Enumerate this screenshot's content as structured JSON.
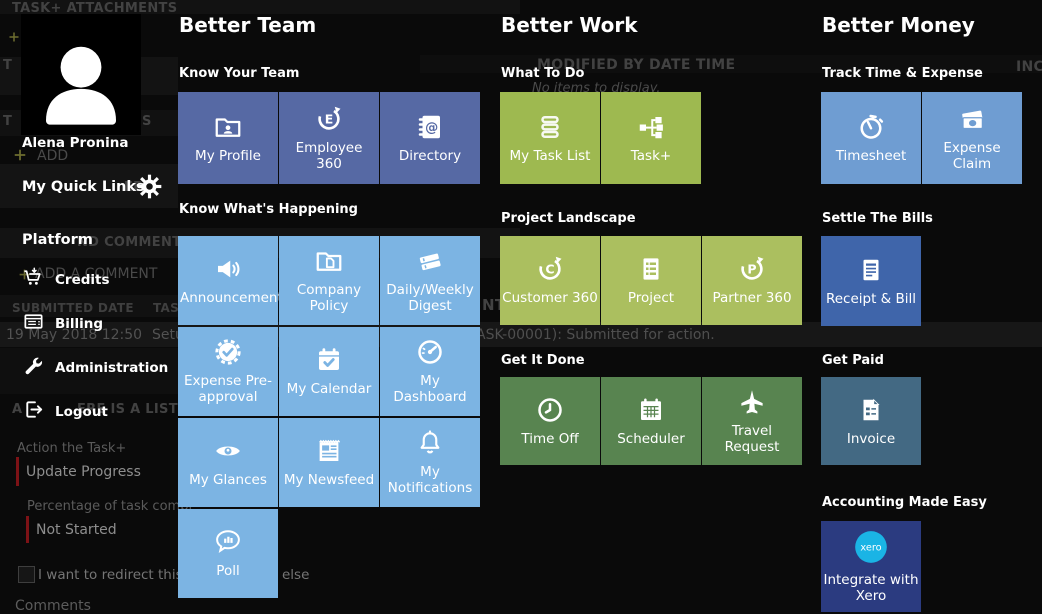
{
  "sidebar": {
    "user_name": "Alena Pronina",
    "quick_links_label": "My Quick Links",
    "platform_label": "Platform",
    "items": [
      {
        "label": "Credits",
        "icon": "cart"
      },
      {
        "label": "Billing",
        "icon": "billing-doc"
      },
      {
        "label": "Administration",
        "icon": "wrench"
      },
      {
        "label": "Logout",
        "icon": "logout-door"
      }
    ]
  },
  "menu": {
    "xero_logo_text": "xero",
    "columns": [
      {
        "title": "Better Team",
        "sections": [
          {
            "heading": "Know Your Team",
            "tile_color": "#5669a4",
            "tiles": [
              {
                "label": "My Profile",
                "icon": "profile-folder"
              },
              {
                "label": "Employee 360",
                "icon": "employee-360"
              },
              {
                "label": "Directory",
                "icon": "directory-book"
              }
            ]
          },
          {
            "heading": "Know What's Happening",
            "tile_color": "#7cb4e3",
            "tiles": [
              {
                "label": "Announcement",
                "icon": "announcement-speaker"
              },
              {
                "label": "Company Policy",
                "icon": "policy-folder"
              },
              {
                "label": "Daily/Weekly Digest",
                "icon": "digest-books"
              },
              {
                "label": "Expense Pre-approval",
                "icon": "preapproval-badge"
              },
              {
                "label": "My Calendar",
                "icon": "calendar-check"
              },
              {
                "label": "My Dashboard",
                "icon": "dashboard-gauge"
              },
              {
                "label": "My Glances",
                "icon": "glances-eye"
              },
              {
                "label": "My Newsfeed",
                "icon": "newsfeed-paper"
              },
              {
                "label": "My Notifications",
                "icon": "notifications-bell"
              },
              {
                "label": "Poll",
                "icon": "poll-bubble"
              }
            ]
          }
        ]
      },
      {
        "title": "Better Work",
        "sections": [
          {
            "heading": "What To Do",
            "tile_color": "#9eb950",
            "tiles": [
              {
                "label": "My Task List",
                "icon": "task-list"
              },
              {
                "label": "Task+",
                "icon": "task-plus"
              }
            ]
          },
          {
            "heading": "Project Landscape",
            "tile_color": "#abbf5f",
            "tiles": [
              {
                "label": "Customer 360",
                "icon": "customer-360"
              },
              {
                "label": "Project",
                "icon": "project-doc"
              },
              {
                "label": "Partner 360",
                "icon": "partner-360"
              }
            ]
          },
          {
            "heading": "Get It Done",
            "tile_color": "#588450",
            "tiles": [
              {
                "label": "Time Off",
                "icon": "timeoff-clock"
              },
              {
                "label": "Scheduler",
                "icon": "scheduler-calendar"
              },
              {
                "label": "Travel Request",
                "icon": "travel-plane"
              }
            ]
          }
        ]
      },
      {
        "title": "Better Money",
        "sections": [
          {
            "heading": "Track Time & Expense",
            "tile_color": "#6f9dd2",
            "tiles": [
              {
                "label": "Timesheet",
                "icon": "timesheet-stopwatch"
              },
              {
                "label": "Expense Claim",
                "icon": "expense-money"
              }
            ]
          },
          {
            "heading": "Settle The Bills",
            "tile_color": "#3f65aa",
            "tiles": [
              {
                "label": "Receipt & Bill",
                "icon": "receipt-doc"
              }
            ]
          },
          {
            "heading": "Get Paid",
            "tile_color": "#436983",
            "tiles": [
              {
                "label": "Invoice",
                "icon": "invoice-doc"
              }
            ]
          },
          {
            "heading": "Accounting Made Easy",
            "tile_color": "#2b3b80",
            "tiles": [
              {
                "label": "Integrate with Xero",
                "icon": "xero-logo"
              }
            ]
          }
        ]
      }
    ]
  },
  "background": {
    "sections_header": "TASK+ ATTACHMENTS",
    "fragment_t1": "T",
    "fragment_t2": "T",
    "fragment_s": "S",
    "fragment_er": "ER",
    "fragment_inc": "INC",
    "fragment_nt": "NT",
    "add_button": "ADD",
    "history_header_fragment": "ND COMMENTS",
    "add_comment": "ADD A COMMENT",
    "submitted_date_header": "SUBMITTED DATE",
    "task_header_fragment": "TAS",
    "submitted_date_value": "19 May 2018 12:50",
    "task_value_fragment": "Setu",
    "status_fragment": "ASK-00001): Submitted for action.",
    "modified_by_header": "MODIFIED BY DATE TIME",
    "no_items": "No items to display.",
    "list_fragment_a": "A",
    "list_fragment": "ERE IS A LIST OF",
    "form": {
      "action_label": "Action the Task+",
      "action_value": "Update Progress",
      "pct_label": "Percentage of task compl",
      "pct_value": "Not Started",
      "redirect_text": "I want to redirect this t",
      "redirect_tail": "else",
      "comments_label": "Comments"
    }
  },
  "colors": {
    "tile_dark_blue": "#5669a4",
    "tile_light_blue": "#7cb4e3",
    "tile_green": "#9eb950",
    "tile_olive": "#abbf5f",
    "tile_dark_green": "#588450",
    "tile_steel_blue": "#6f9dd2",
    "tile_receipt_blue": "#3f65aa",
    "tile_invoice_slate": "#436983",
    "tile_xero_navy": "#2b3b80",
    "xero_circle": "#1ab4e5",
    "field_accent_red": "#7d1216"
  }
}
